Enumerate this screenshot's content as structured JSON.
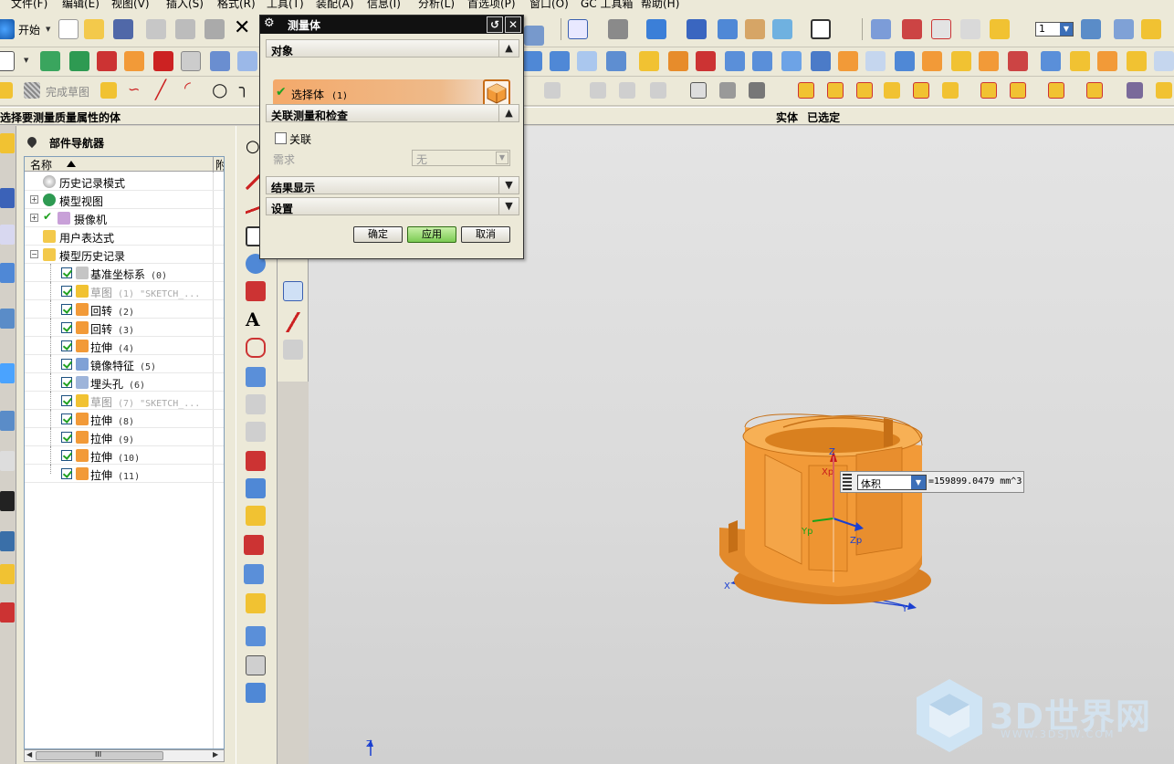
{
  "menu": [
    "文件(F)",
    "编辑(E)",
    "视图(V)",
    "插入(S)",
    "格式(R)",
    "工具(T)",
    "装配(A)",
    "信息(I)",
    "分析(L)",
    "首选项(P)",
    "窗口(O)",
    "GC 工具箱",
    "帮助(H)"
  ],
  "toolbar": {
    "start_label": "开始",
    "finish_sketch_label": "完成草图",
    "layer_value": "1"
  },
  "cue_line": {
    "prompt": "选择要测量质量属性的体",
    "status": "实体 已选定"
  },
  "navigator": {
    "title": "部件导航器",
    "col_name": "名称",
    "col_attach": "附",
    "items": [
      {
        "label": "历史记录模式",
        "seq": "",
        "dim": false
      },
      {
        "label": "模型视图",
        "seq": "",
        "dim": false
      },
      {
        "label": "摄像机",
        "seq": "",
        "dim": false
      },
      {
        "label": "用户表达式",
        "seq": "",
        "dim": false
      },
      {
        "label": "模型历史记录",
        "seq": "",
        "dim": false
      },
      {
        "label": "基准坐标系",
        "seq": "(0)",
        "dim": false
      },
      {
        "label": "草图",
        "seq": "(1) \"SKETCH_...",
        "dim": true
      },
      {
        "label": "回转",
        "seq": "(2)",
        "dim": false
      },
      {
        "label": "回转",
        "seq": "(3)",
        "dim": false
      },
      {
        "label": "拉伸",
        "seq": "(4)",
        "dim": false
      },
      {
        "label": "镜像特征",
        "seq": "(5)",
        "dim": false
      },
      {
        "label": "埋头孔",
        "seq": "(6)",
        "dim": false
      },
      {
        "label": "草图",
        "seq": "(7) \"SKETCH_...",
        "dim": true
      },
      {
        "label": "拉伸",
        "seq": "(8)",
        "dim": false
      },
      {
        "label": "拉伸",
        "seq": "(9)",
        "dim": false
      },
      {
        "label": "拉伸",
        "seq": "(10)",
        "dim": false
      },
      {
        "label": "拉伸",
        "seq": "(11)",
        "dim": false
      }
    ],
    "scroll_mid": "III"
  },
  "dialog": {
    "title": "测量体",
    "group_object": "对象",
    "select_body": "选择体",
    "select_count": "(1)",
    "group_assoc": "关联测量和检查",
    "assoc_label": "关联",
    "requirement_label": "需求",
    "requirement_value": "无",
    "group_results": "结果显示",
    "group_settings": "设置",
    "ok": "确定",
    "apply": "应用",
    "cancel": "取消"
  },
  "measurement": {
    "property": "体积",
    "value": "=159899.0479 mm^3"
  },
  "axes": {
    "z": "Z",
    "xp": "Xp",
    "yp": "Yp",
    "zp": "Zp",
    "x": "X",
    "y": "Y",
    "mini_z": "Z"
  },
  "watermark": {
    "text": "3D世界网",
    "url": "WWW.3DSJW.COM"
  },
  "colors": {
    "part": "#f29a38",
    "accent": "#7ccb53",
    "title_bar": "#111111"
  }
}
